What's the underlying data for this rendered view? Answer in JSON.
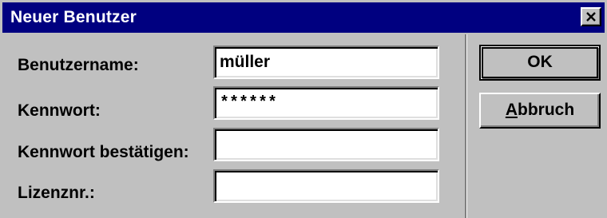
{
  "window": {
    "title": "Neuer Benutzer",
    "close_icon": "close-icon"
  },
  "form": {
    "username": {
      "label": "Benutzername:",
      "value": "müller"
    },
    "password": {
      "label": "Kennwort:",
      "value": "******"
    },
    "confirm": {
      "label": "Kennwort bestätigen:",
      "value": ""
    },
    "license": {
      "label": "Lizenznr.:",
      "value": ""
    }
  },
  "buttons": {
    "ok_label": "OK",
    "cancel_mnemonic": "A",
    "cancel_rest": "bbruch"
  }
}
